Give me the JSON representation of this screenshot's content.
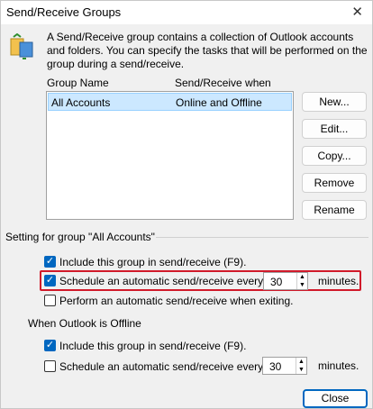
{
  "window": {
    "title": "Send/Receive Groups"
  },
  "intro": "A Send/Receive group contains a collection of Outlook accounts and folders. You can specify the tasks that will be performed on the group during a send/receive.",
  "list": {
    "col_group_name": "Group Name",
    "col_when": "Send/Receive when",
    "rows": [
      {
        "name": "All Accounts",
        "when": "Online and Offline"
      }
    ]
  },
  "buttons": {
    "new": "New...",
    "edit": "Edit...",
    "copy": "Copy...",
    "remove": "Remove",
    "rename": "Rename",
    "close": "Close"
  },
  "online": {
    "heading": "Setting for group \"All Accounts\"",
    "include_label": "Include this group in send/receive (F9).",
    "include_checked": true,
    "schedule_label": "Schedule an automatic send/receive every",
    "schedule_checked": true,
    "schedule_minutes": "30",
    "minutes_label": "minutes.",
    "exit_label": "Perform an automatic send/receive when exiting.",
    "exit_checked": false
  },
  "offline": {
    "heading": "When Outlook is Offline",
    "include_label": "Include this group in send/receive (F9).",
    "include_checked": true,
    "schedule_label": "Schedule an automatic send/receive every",
    "schedule_checked": false,
    "schedule_minutes": "30",
    "minutes_label": "minutes."
  },
  "colors": {
    "accent": "#0067c0",
    "highlight": "#d11a2a",
    "selection": "#cce8ff"
  }
}
